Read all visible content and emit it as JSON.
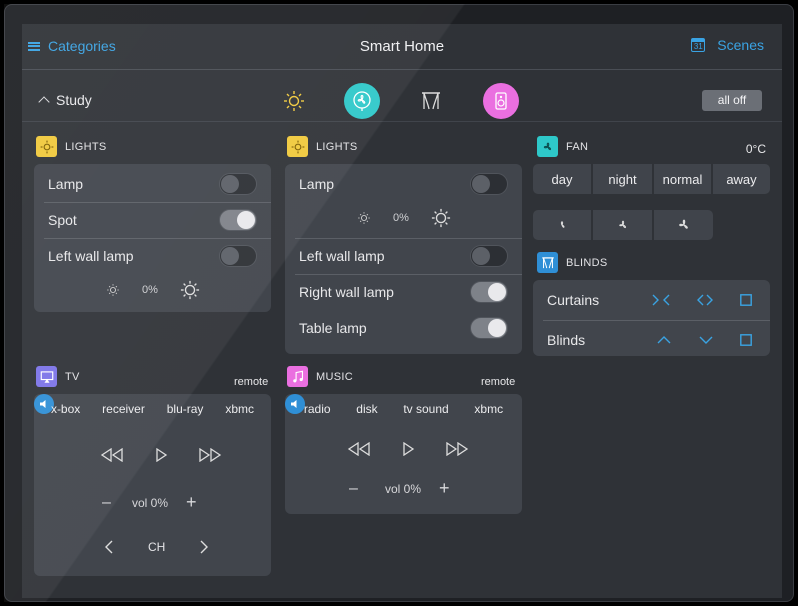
{
  "header": {
    "left_label": "Categories",
    "title": "Smart Home",
    "right_label": "Scenes",
    "calendar_day": "31"
  },
  "room": {
    "name": "Study",
    "all_off": "all off"
  },
  "colors": {
    "accent": "#3aa3e3",
    "lights": "#f0c93c",
    "fan": "#2ec8c9",
    "music": "#ea6fe0",
    "tv": "#7c74e8"
  },
  "lights1": {
    "title": "LIGHTS",
    "rows": [
      {
        "label": "Lamp",
        "state": "off"
      },
      {
        "label": "Spot",
        "state": "on"
      },
      {
        "label": "Left wall lamp",
        "state": "off"
      }
    ],
    "dim_value": "0%"
  },
  "lights2": {
    "title": "LIGHTS",
    "lamp_label": "Lamp",
    "lamp_state": "off",
    "dim_value": "0%",
    "rows": [
      {
        "label": "Left wall lamp",
        "state": "off"
      },
      {
        "label": "Right wall lamp",
        "state": "on"
      },
      {
        "label": "Table lamp",
        "state": "on"
      }
    ]
  },
  "fan": {
    "title": "FAN",
    "temperature": "0°C",
    "modes": [
      "day",
      "night",
      "normal",
      "away"
    ],
    "speed_icons": [
      "fan-low-icon",
      "fan-medium-icon",
      "fan-high-icon"
    ]
  },
  "blinds": {
    "title": "BLINDS",
    "rows": [
      {
        "label": "Curtains"
      },
      {
        "label": "Blinds"
      }
    ]
  },
  "tv": {
    "title": "TV",
    "remote": "remote",
    "sources": [
      "x-box",
      "receiver",
      "blu-ray",
      "xbmc"
    ],
    "volume": "vol 0%",
    "channel": "CH"
  },
  "music": {
    "title": "MUSIC",
    "remote": "remote",
    "sources": [
      "radio",
      "disk",
      "tv sound",
      "xbmc"
    ],
    "volume": "vol 0%"
  }
}
